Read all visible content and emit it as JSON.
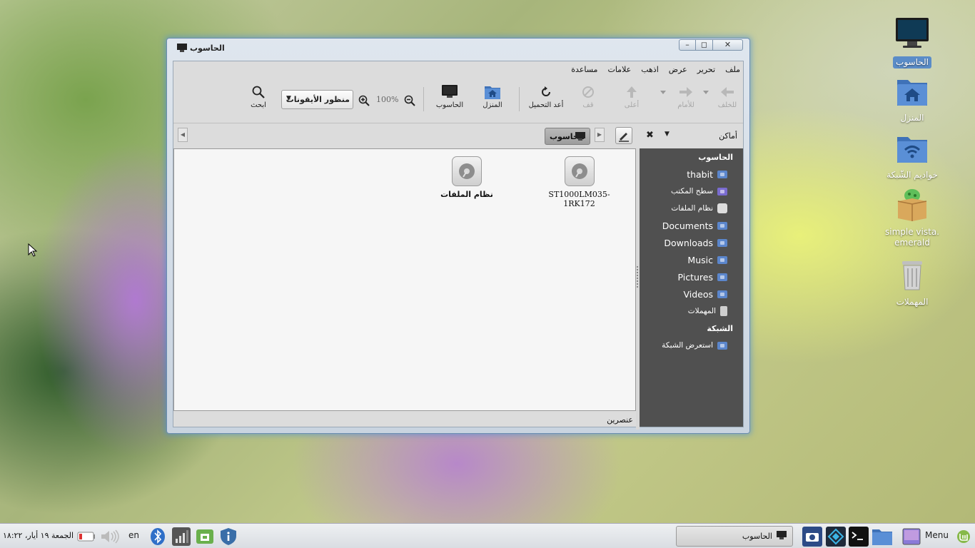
{
  "desktop": {
    "icons": [
      {
        "label": "الحاسوب",
        "icon": "computer-icon"
      },
      {
        "label": "المنزل",
        "icon": "home-folder-icon"
      },
      {
        "label": "خواديم الشّبكة",
        "icon": "network-folder-icon"
      },
      {
        "label": "simple vista.\nemerald",
        "icon": "package-icon"
      },
      {
        "label": "المهملات",
        "icon": "trash-icon"
      }
    ]
  },
  "window": {
    "title": "الحاسوب",
    "controls": {
      "minimize": "–",
      "maximize": "◻",
      "close": "✕"
    },
    "menu": [
      "ملف",
      "تحرير",
      "عرض",
      "اذهب",
      "علامات",
      "مساعدة"
    ],
    "toolbar": {
      "back": "للخلف",
      "forward": "للأمام",
      "up": "أعلى",
      "stop": "قف",
      "reload": "أعد التحميل",
      "home": "المنزل",
      "computer": "الحاسوب",
      "zoom": "100%",
      "view_mode": "منظور الأيقونات",
      "search": "ابحث"
    },
    "location": {
      "crumb": "الحاسوب",
      "places_label": "أماكن"
    },
    "files": [
      {
        "name": "ST1000LM035-1RK172",
        "icon": "hard-drive-icon"
      },
      {
        "name": "نظام الملفات",
        "icon": "hard-drive-icon"
      }
    ],
    "sidebar": {
      "computer_header": "الحاسوب",
      "computer_items": [
        {
          "label": "thabit",
          "icon": "home-icon"
        },
        {
          "label": "سطح المكتب",
          "icon": "desktop-icon"
        },
        {
          "label": "نظام الملفات",
          "icon": "drive-icon"
        },
        {
          "label": "Documents",
          "icon": "folder-icon"
        },
        {
          "label": "Downloads",
          "icon": "folder-icon"
        },
        {
          "label": "Music",
          "icon": "folder-icon"
        },
        {
          "label": "Pictures",
          "icon": "folder-icon"
        },
        {
          "label": "Videos",
          "icon": "folder-icon"
        },
        {
          "label": "المهملات",
          "icon": "trash-icon"
        }
      ],
      "network_header": "الشبكة",
      "network_items": [
        {
          "label": "استعرض الشبكة",
          "icon": "network-icon"
        }
      ]
    },
    "status": "عنصرين"
  },
  "panel": {
    "menu_label": "Menu",
    "task_title": "الحاسوب",
    "lang": "en",
    "clock": "الجمعة ١٩ أيار، ١٨:٢٢"
  },
  "colors": {
    "sidebar_bg": "#505050",
    "window_glow": "#468cdc",
    "folder_blue": "#5b86cc",
    "selection": "#5a8cc8"
  }
}
